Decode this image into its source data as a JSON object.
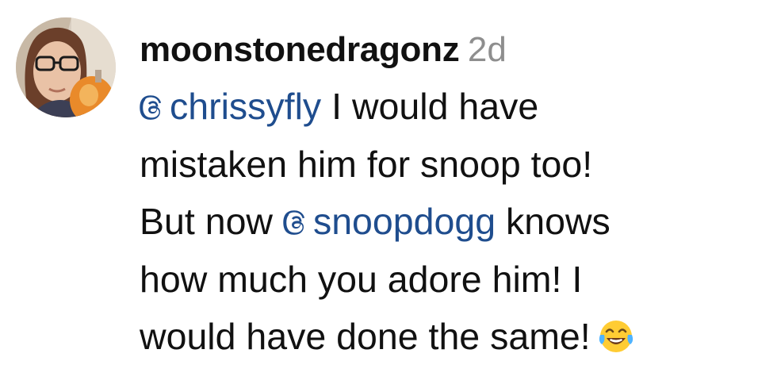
{
  "comment": {
    "username": "moonstonedragonz",
    "time": "2d",
    "avatar_icon": "profile-photo",
    "mention_icon": "threads-icon",
    "mention_color": "#1f4d8e",
    "lines": {
      "l1_mention": "chrissyfly",
      "l1_text": " I would have",
      "l2_text": "mistaken him for snoop too!",
      "l3_text_a": "But now ",
      "l3_mention": "snoopdogg",
      "l3_text_b": " knows",
      "l4_text": "how much you adore him! I",
      "l5_text": "would have done the same!",
      "emoji": "face-with-tears-of-joy"
    }
  }
}
